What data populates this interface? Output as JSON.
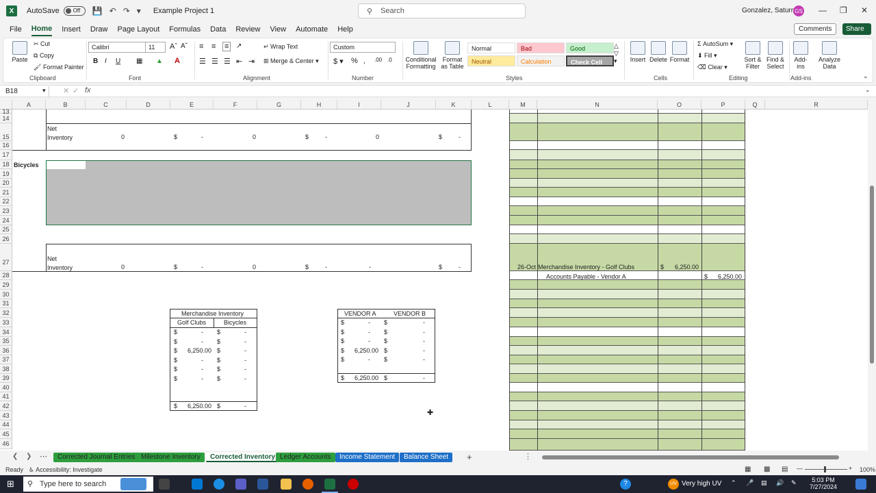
{
  "title_bar": {
    "autosave_label": "AutoSave",
    "autosave_state": "Off",
    "document_title": "Example Project 1",
    "search_placeholder": "Search",
    "user_name": "Gonzalez, Saturnino",
    "user_initials": "GS"
  },
  "menu": {
    "items": [
      "File",
      "Home",
      "Insert",
      "Draw",
      "Page Layout",
      "Formulas",
      "Data",
      "Review",
      "View",
      "Automate",
      "Help"
    ],
    "active": "Home",
    "comments_label": "Comments",
    "share_label": "Share"
  },
  "ribbon": {
    "clipboard": {
      "paste": "Paste",
      "cut": "Cut",
      "copy": "Copy",
      "format_painter": "Format Painter",
      "label": "Clipboard"
    },
    "font": {
      "name": "Calibri",
      "size": "11",
      "label": "Font"
    },
    "alignment": {
      "wrap_text": "Wrap Text",
      "merge_center": "Merge & Center",
      "label": "Alignment"
    },
    "number": {
      "format": "Custom",
      "label": "Number"
    },
    "styles": {
      "conditional": "Conditional Formatting",
      "format_as_table": "Format as Table",
      "cells": [
        {
          "name": "Normal",
          "bg": "#ffffff",
          "fg": "#000000"
        },
        {
          "name": "Bad",
          "bg": "#ffc7ce",
          "fg": "#9c0006"
        },
        {
          "name": "Good",
          "bg": "#c6efce",
          "fg": "#006100"
        },
        {
          "name": "Neutral",
          "bg": "#ffeb9c",
          "fg": "#9c5700"
        },
        {
          "name": "Calculation",
          "bg": "#f2f2f2",
          "fg": "#fa7d00"
        },
        {
          "name": "Check Cell",
          "bg": "#a5a5a5",
          "fg": "#ffffff"
        }
      ],
      "label": "Styles"
    },
    "cells": {
      "insert": "Insert",
      "delete": "Delete",
      "format": "Format",
      "label": "Cells"
    },
    "editing": {
      "autosum": "AutoSum",
      "fill": "Fill",
      "clear": "Clear",
      "sort_filter": "Sort & Filter",
      "find_select": "Find & Select",
      "label": "Editing"
    },
    "addins": {
      "addins": "Add-ins",
      "analyze": "Analyze Data",
      "label": "Add-ins"
    }
  },
  "formula_bar": {
    "name_box": "B18",
    "fx": "fx",
    "content": ""
  },
  "columns": [
    "A",
    "B",
    "C",
    "D",
    "E",
    "F",
    "G",
    "H",
    "I",
    "J",
    "K",
    "L",
    "M",
    "N",
    "O",
    "P",
    "Q",
    "R"
  ],
  "rows": [
    "13",
    "14",
    "15",
    "16",
    "17",
    "18",
    "19",
    "20",
    "21",
    "22",
    "23",
    "24",
    "25",
    "26",
    "27",
    "28",
    "29",
    "30",
    "31",
    "32",
    "33",
    "34",
    "35",
    "36",
    "37",
    "38",
    "39",
    "40",
    "41",
    "42",
    "43",
    "44",
    "45",
    "46"
  ],
  "cells": {
    "net_inventory_1": "Net Inventory",
    "bicycles_label": "Bicycles",
    "net_inventory_2": "Net Inventory",
    "zero": "0",
    "dollar": "$",
    "dash": "-",
    "journal_date": "26-Oct",
    "journal_debit_acct": "Merchandise Inventory - Golf Clubs",
    "journal_debit_amt": "6,250.00",
    "journal_credit_acct": "Accounts Payable - Vendor A",
    "journal_credit_amt": "6,250.00"
  },
  "merch_table": {
    "title": "Merchandise Inventory",
    "col1": "Golf Clubs",
    "col2": "Bicycles",
    "rows": [
      [
        "-",
        "-"
      ],
      [
        "-",
        "-"
      ],
      [
        "6,250.00",
        "-"
      ],
      [
        "-",
        "-"
      ],
      [
        "-",
        "-"
      ],
      [
        "-",
        "-"
      ]
    ],
    "total": [
      "6,250.00",
      "-"
    ]
  },
  "vendor_table": {
    "col1": "VENDOR A",
    "col2": "VENDOR B",
    "rows": [
      [
        "-",
        "-"
      ],
      [
        "-",
        "-"
      ],
      [
        "-",
        "-"
      ],
      [
        "6,250.00",
        "-"
      ],
      [
        "-",
        "-"
      ]
    ],
    "total": [
      "6,250.00",
      "-"
    ]
  },
  "sheets": [
    {
      "name": "Corrected Journal Entries",
      "style": "green"
    },
    {
      "name": "Milestone Inventory",
      "style": "green"
    },
    {
      "name": "Corrected Inventory",
      "style": "active"
    },
    {
      "name": "Ledger Accounts",
      "style": "green"
    },
    {
      "name": "Income Statement",
      "style": "blue"
    },
    {
      "name": "Balance Sheet",
      "style": "blue"
    }
  ],
  "status": {
    "ready": "Ready",
    "accessibility": "Accessibility: Investigate",
    "zoom": "100%"
  },
  "taskbar": {
    "search_placeholder": "Type here to search",
    "uv": "Very high UV",
    "time": "5:03 PM",
    "date": "7/27/2024"
  }
}
